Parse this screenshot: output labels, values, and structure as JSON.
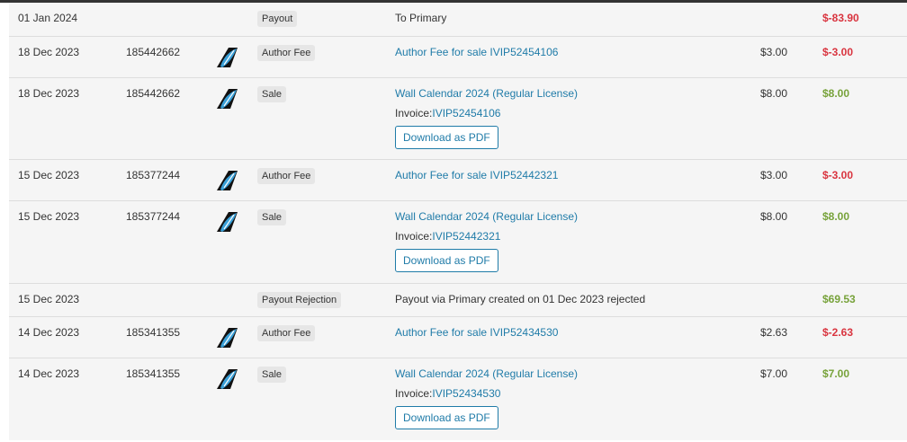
{
  "buttons": {
    "download_pdf": "Download as PDF"
  },
  "invoice_prefix": "Invoice:",
  "colors": {
    "negative": "#d9343f",
    "positive": "#77a23a",
    "link": "#1f7ba8"
  },
  "rows": [
    {
      "date": "01 Jan 2024",
      "item_id": "",
      "type": "Payout",
      "description": "To Primary",
      "description_is_link": false,
      "price": "",
      "amount": "$-83.90",
      "amount_sign": "negative"
    },
    {
      "date": "18 Dec 2023",
      "item_id": "185442662",
      "type": "Author Fee",
      "description": "Author Fee for sale IVIP52454106",
      "description_is_link": true,
      "price": "$3.00",
      "amount": "$-3.00",
      "amount_sign": "negative"
    },
    {
      "date": "18 Dec 2023",
      "item_id": "185442662",
      "type": "Sale",
      "description": "Wall Calendar 2024 (Regular License)",
      "description_is_link": true,
      "invoice": "IVIP52454106",
      "price": "$8.00",
      "amount": "$8.00",
      "amount_sign": "positive"
    },
    {
      "date": "15 Dec 2023",
      "item_id": "185377244",
      "type": "Author Fee",
      "description": "Author Fee for sale IVIP52442321",
      "description_is_link": true,
      "price": "$3.00",
      "amount": "$-3.00",
      "amount_sign": "negative"
    },
    {
      "date": "15 Dec 2023",
      "item_id": "185377244",
      "type": "Sale",
      "description": "Wall Calendar 2024 (Regular License)",
      "description_is_link": true,
      "invoice": "IVIP52442321",
      "price": "$8.00",
      "amount": "$8.00",
      "amount_sign": "positive"
    },
    {
      "date": "15 Dec 2023",
      "item_id": "",
      "type": "Payout Rejection",
      "description": "Payout via Primary created on 01 Dec 2023 rejected",
      "description_is_link": false,
      "price": "",
      "amount": "$69.53",
      "amount_sign": "positive"
    },
    {
      "date": "14 Dec 2023",
      "item_id": "185341355",
      "type": "Author Fee",
      "description": "Author Fee for sale IVIP52434530",
      "description_is_link": true,
      "price": "$2.63",
      "amount": "$-2.63",
      "amount_sign": "negative"
    },
    {
      "date": "14 Dec 2023",
      "item_id": "185341355",
      "type": "Sale",
      "description": "Wall Calendar 2024 (Regular License)",
      "description_is_link": true,
      "invoice": "IVIP52434530",
      "price": "$7.00",
      "amount": "$7.00",
      "amount_sign": "positive"
    }
  ]
}
